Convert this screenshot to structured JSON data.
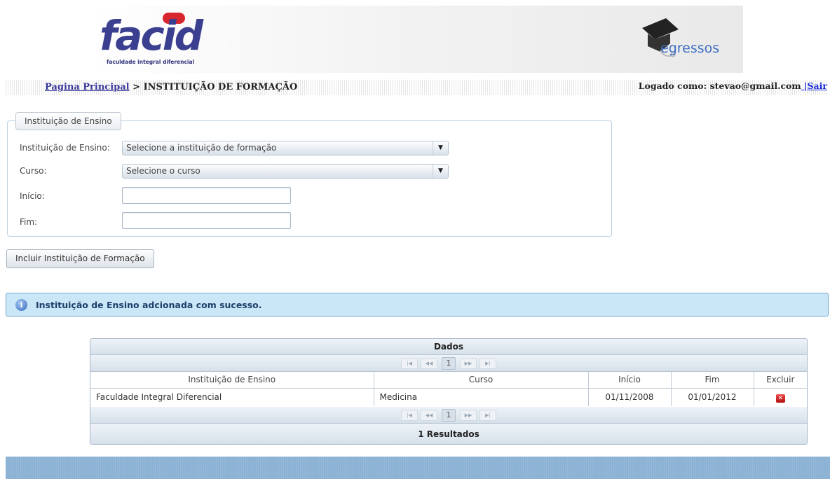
{
  "header": {
    "logo_text": "facid",
    "logo_subtitle": "faculdade integral diferencial",
    "logo_badge": "",
    "egressos_text": "egressos"
  },
  "breadcrumb": {
    "home_link": "Pagina Principal",
    "separator": " > ",
    "current": "INSTITUIÇÃO DE FORMAÇÃO"
  },
  "user": {
    "logged_prefix": "Logado como: ",
    "email": "stevao@gmail.com",
    "separator": " |",
    "logout": "Sair"
  },
  "form": {
    "legend": "Instituição de Ensino",
    "institution_label": "Instituição de Ensino:",
    "institution_value": "Selecione a instituição de formação",
    "course_label": "Curso:",
    "course_value": "Selecione o curso",
    "start_label": "Início:",
    "start_value": "",
    "end_label": "Fim:",
    "end_value": "",
    "submit_label": "Incluir Instituição de Formação"
  },
  "message": {
    "text": "Instituição de Ensino adcionada com sucesso."
  },
  "table": {
    "title": "Dados",
    "current_page": "1",
    "columns": [
      "Instituição de Ensino",
      "Curso",
      "Início",
      "Fim",
      "Excluir"
    ],
    "rows": [
      {
        "institution": "Faculdade Integral Diferencial",
        "course": "Medicina",
        "start": "01/11/2008",
        "end": "01/01/2012"
      }
    ],
    "results": "1 Resultados"
  },
  "colors": {
    "message_bg": "#c9e7f7",
    "logo_blue": "#3b3f8f",
    "link_blue": "#1a2bd6",
    "delete_red": "#c41b1b",
    "bottom_band": "#8bb2d4"
  }
}
